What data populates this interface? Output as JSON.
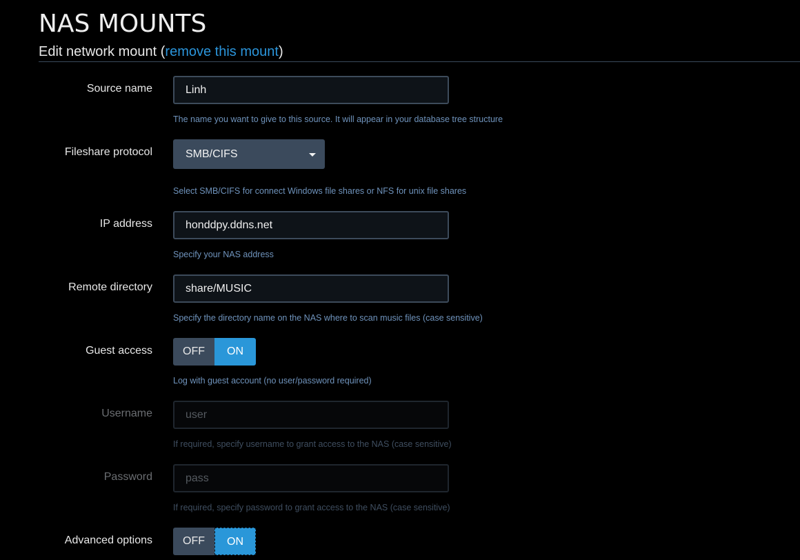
{
  "page": {
    "title": "NAS MOUNTS",
    "legend_prefix": "Edit network mount (",
    "remove_link": "remove this mount",
    "legend_suffix": ")"
  },
  "fields": {
    "source_name": {
      "label": "Source name",
      "value": "Linh",
      "help": "The name you want to give to this source. It will appear in your database tree structure"
    },
    "protocol": {
      "label": "Fileshare protocol",
      "value": "SMB/CIFS",
      "help": "Select SMB/CIFS for connect Windows file shares or NFS for unix file shares"
    },
    "ip_address": {
      "label": "IP address",
      "value": "honddpy.ddns.net",
      "help": "Specify your NAS address"
    },
    "remote_directory": {
      "label": "Remote directory",
      "value": "share/MUSIC",
      "help": "Specify the directory name on the NAS where to scan music files (case sensitive)"
    },
    "guest_access": {
      "label": "Guest access",
      "off": "OFF",
      "on": "ON",
      "state": "ON",
      "help": "Log with guest account (no user/password required)"
    },
    "username": {
      "label": "Username",
      "placeholder": "user",
      "help": "If required, specify username to grant access to the NAS (case sensitive)"
    },
    "password": {
      "label": "Password",
      "placeholder": "pass",
      "help": "If required, specify password to grant access to the NAS (case sensitive)"
    },
    "advanced_options": {
      "label": "Advanced options",
      "off": "OFF",
      "on": "ON",
      "state": "ON"
    }
  },
  "colors": {
    "accent": "#2a97d9",
    "link": "#2b95db",
    "help_text": "#6f93bc",
    "control_bg": "#3b4a5c"
  }
}
